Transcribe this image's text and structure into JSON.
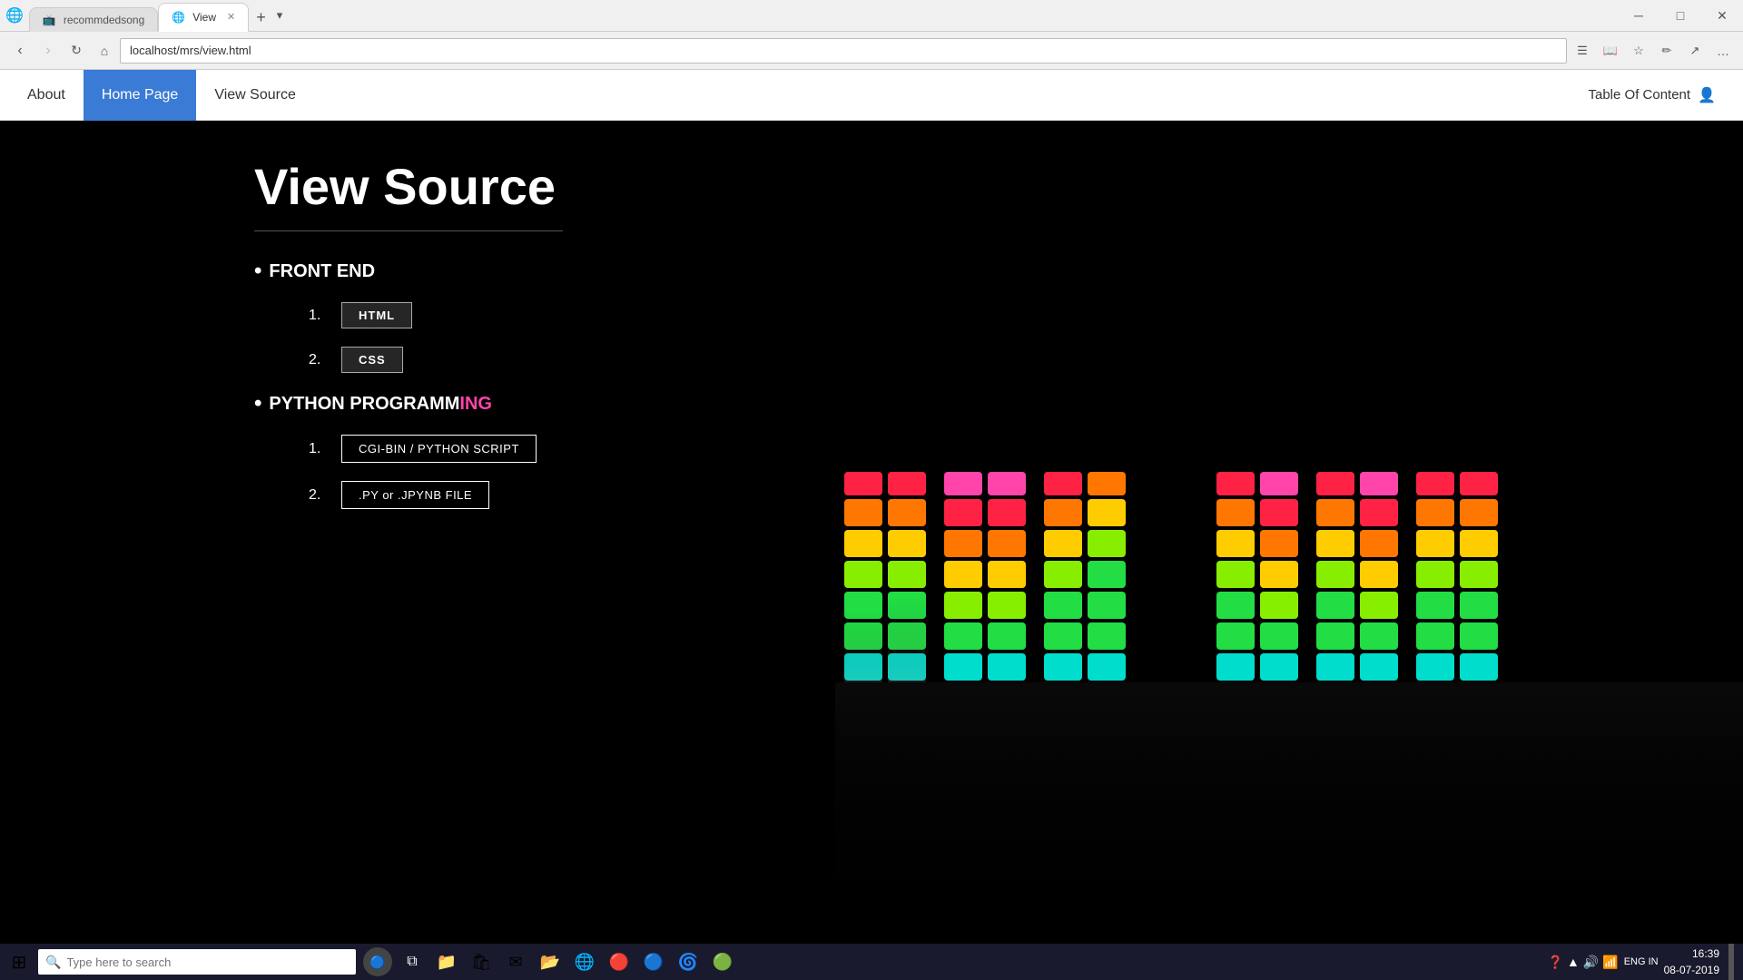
{
  "browser": {
    "tabs": [
      {
        "label": "recommdedsong",
        "active": false,
        "icon": "🎵"
      },
      {
        "label": "View",
        "active": true,
        "icon": "🌐"
      }
    ],
    "address": "localhost/mrs/view.html",
    "window_controls": [
      "─",
      "□",
      "✕"
    ]
  },
  "nav": {
    "items": [
      {
        "label": "About",
        "active": false
      },
      {
        "label": "Home Page",
        "active": true
      },
      {
        "label": "View Source",
        "active": false
      }
    ],
    "right": "Table Of Content"
  },
  "main": {
    "title": "View Source",
    "sections": [
      {
        "heading": "FRONT END",
        "items": [
          {
            "num": "1.",
            "label": "HTML"
          },
          {
            "num": "2.",
            "label": "CSS"
          }
        ]
      },
      {
        "heading": "PYTHON PROGRAMMING",
        "items": [
          {
            "num": "1.",
            "label": "CGI-BIN / PYTHON SCRIPT"
          },
          {
            "num": "2.",
            "label": ".PY or .JPYNB FILE"
          }
        ]
      }
    ]
  },
  "taskbar": {
    "search_placeholder": "Type here to search",
    "time": "16:39",
    "date": "08-07-2019",
    "lang": "ENG\nIN"
  }
}
